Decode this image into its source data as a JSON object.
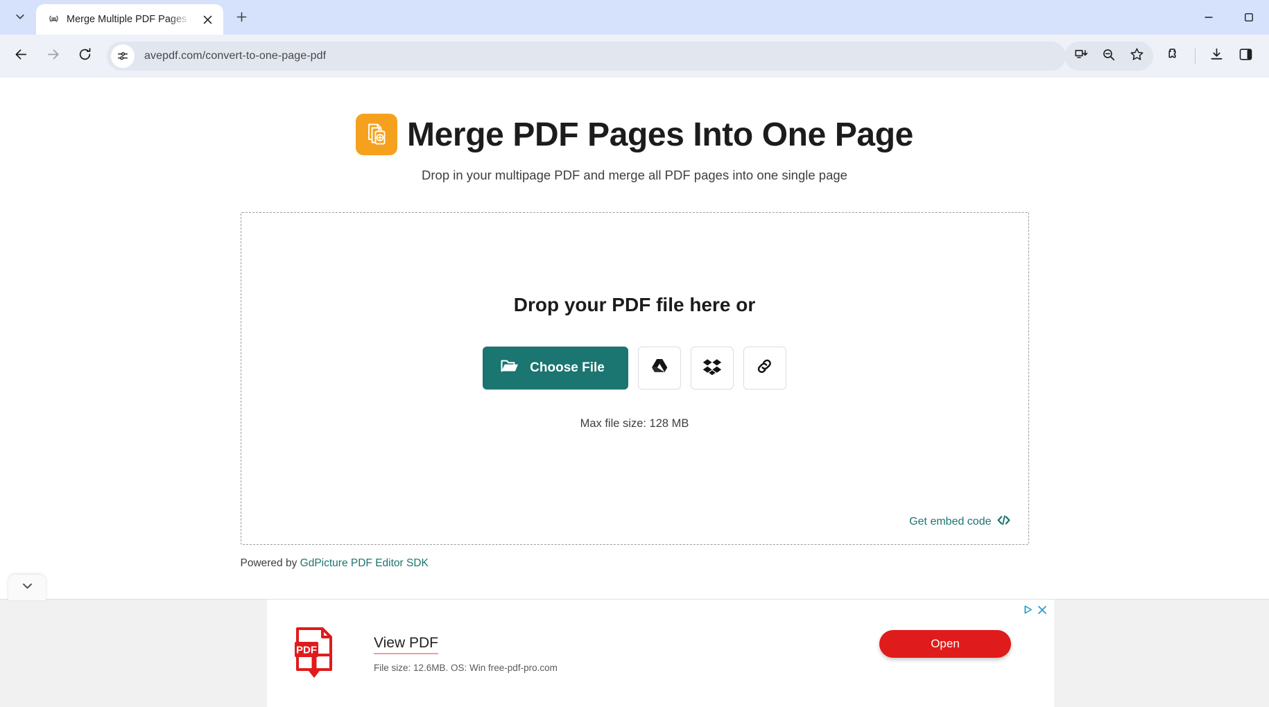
{
  "browser": {
    "tab": {
      "title": "Merge Multiple PDF Pages Into",
      "favicon_icon": "pdf-laurel-favicon",
      "close_icon": "close-icon"
    },
    "tab_search_icon": "chevron-down-icon",
    "new_tab_icon": "plus-icon",
    "window_controls": {
      "minimize_icon": "minimize-icon",
      "maximize_icon": "maximize-icon"
    },
    "nav": {
      "back_icon": "arrow-left-icon",
      "forward_icon": "arrow-right-icon",
      "reload_icon": "reload-icon"
    },
    "omnibox": {
      "url": "avepdf.com/convert-to-one-page-pdf",
      "site_info_icon": "site-settings-icon"
    },
    "toolbar_icons": [
      "install-app-icon",
      "zoom-out-icon",
      "bookmark-star-icon",
      "extensions-puzzle-icon",
      "downloads-icon",
      "side-panel-icon"
    ]
  },
  "page": {
    "logo_icon": "merge-pdf-pages-logo",
    "title": "Merge PDF Pages Into One Page",
    "subtitle": "Drop in your multipage PDF and merge all PDF pages into one single page",
    "dropzone": {
      "heading": "Drop your PDF file here or",
      "choose_file_label": "Choose File",
      "choose_file_icon": "folder-open-icon",
      "sources": [
        {
          "name": "google-drive",
          "icon": "google-drive-icon"
        },
        {
          "name": "dropbox",
          "icon": "dropbox-icon"
        },
        {
          "name": "url-link",
          "icon": "link-icon"
        }
      ],
      "max_file_size": "Max file size: 128 MB",
      "embed_label": "Get embed code",
      "embed_icon": "code-brackets-icon"
    },
    "powered_prefix": "Powered by ",
    "powered_link": "GdPicture PDF Editor SDK"
  },
  "ad": {
    "collapse_icon": "chevron-down-icon",
    "product_icon": "pdf-download-icon",
    "headline": "View PDF",
    "subtext": "File size: 12.6MB. OS: Win free-pdf-pro.com",
    "cta_label": "Open",
    "adchoices_icon": "adchoices-icon",
    "close_icon": "close-icon"
  },
  "colors": {
    "accent_teal": "#1b7570",
    "logo_orange": "#f5a11d",
    "ad_red": "#e01b1b",
    "tabstrip_blue": "#d6e2fb"
  }
}
